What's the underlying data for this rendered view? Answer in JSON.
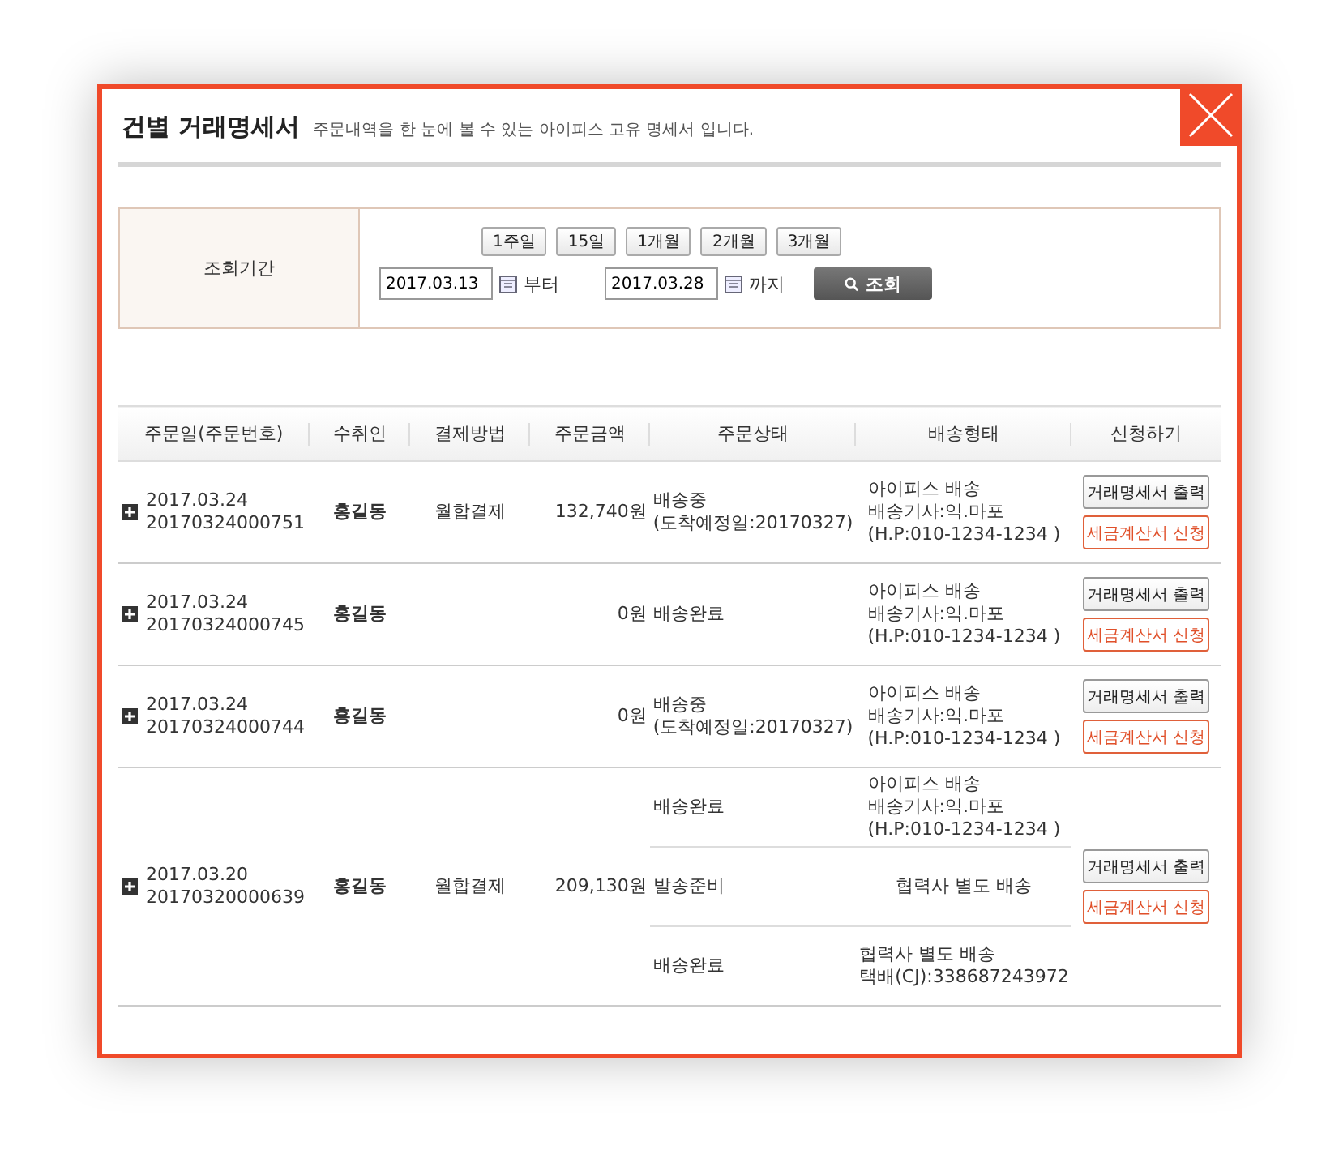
{
  "dialog": {
    "title": "건별 거래명세서",
    "subtitle": "주문내역을 한 눈에 볼 수 있는 아이피스 고유 명세서 입니다."
  },
  "search": {
    "label": "조회기간",
    "periods": [
      "1주일",
      "15일",
      "1개월",
      "2개월",
      "3개월"
    ],
    "from_date": "2017.03.13",
    "from_suffix": "부터",
    "to_date": "2017.03.28",
    "to_suffix": "까지",
    "button": "조회"
  },
  "table": {
    "columns": [
      "주문일(주문번호)",
      "수취인",
      "결제방법",
      "주문금액",
      "주문상태",
      "배송형태",
      "신청하기"
    ],
    "rows": [
      {
        "date": "2017.03.24",
        "order_no": "20170324000751",
        "recipient": "홍길동",
        "payment": "월합결제",
        "amount": "132,740원",
        "shipments": [
          {
            "status": [
              "배송중",
              "(도착예정일:20170327)"
            ],
            "delivery": [
              "아이피스 배송",
              "배송기사:익.마포",
              "(H.P:010-1234-1234 )"
            ]
          }
        ],
        "buttons": [
          "거래명세서 출력",
          "세금계산서 신청"
        ]
      },
      {
        "date": "2017.03.24",
        "order_no": "20170324000745",
        "recipient": "홍길동",
        "amount": "0원",
        "shipments": [
          {
            "status": [
              "배송완료"
            ],
            "delivery": [
              "아이피스 배송",
              "배송기사:익.마포",
              "(H.P:010-1234-1234 )"
            ]
          }
        ],
        "buttons": [
          "거래명세서 출력",
          "세금계산서 신청"
        ]
      },
      {
        "date": "2017.03.24",
        "order_no": "20170324000744",
        "recipient": "홍길동",
        "amount": "0원",
        "shipments": [
          {
            "status": [
              "배송중",
              "(도착예정일:20170327)"
            ],
            "delivery": [
              "아이피스 배송",
              "배송기사:익.마포",
              "(H.P:010-1234-1234 )"
            ]
          }
        ],
        "buttons": [
          "거래명세서 출력",
          "세금계산서 신청"
        ]
      },
      {
        "date": "2017.03.20",
        "order_no": "20170320000639",
        "recipient": "홍길동",
        "payment": "월합결제",
        "amount": "209,130원",
        "shipments": [
          {
            "status": [
              "배송완료"
            ],
            "delivery": [
              "아이피스 배송",
              "배송기사:익.마포",
              "(H.P:010-1234-1234 )"
            ]
          },
          {
            "status": [
              "발송준비"
            ],
            "delivery": [
              "협력사 별도 배송"
            ]
          },
          {
            "status": [
              "배송완료"
            ],
            "delivery": [
              "협력사 별도 배송",
              "택배(CJ):338687243972"
            ]
          }
        ],
        "buttons": [
          "거래명세서 출력",
          "세금계산서 신청"
        ]
      }
    ]
  }
}
